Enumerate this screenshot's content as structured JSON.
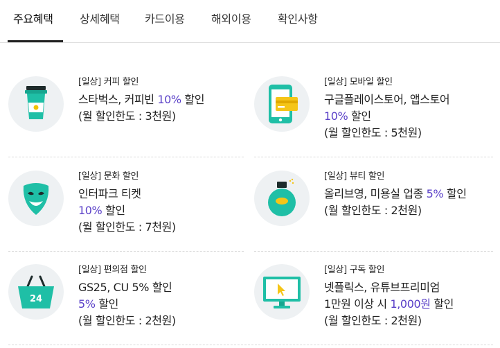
{
  "tabs": [
    {
      "label": "주요혜택"
    },
    {
      "label": "상세혜택"
    },
    {
      "label": "카드이용"
    },
    {
      "label": "해외이용"
    },
    {
      "label": "확인사항"
    }
  ],
  "benefits": [
    {
      "category": "[일상] 커피 할인",
      "line1_pre": "스타벅스, 커피빈 ",
      "line1_hl": "10%",
      "line1_post": " 할인",
      "line2_pre": "(월 할인한도 : 3천원)",
      "line2_hl": "",
      "line2_post": "",
      "line3": "",
      "icon": "coffee-cup-icon"
    },
    {
      "category": "[일상] 모바일 할인",
      "line1_pre": "구글플레이스토어, 앱스토어",
      "line1_hl": "",
      "line1_post": "",
      "line2_pre": "",
      "line2_hl": "10%",
      "line2_post": " 할인",
      "line3": "(월 할인한도 : 5천원)",
      "icon": "smartphone-card-icon"
    },
    {
      "category": "[일상] 문화 할인",
      "line1_pre": "인터파크 티켓",
      "line1_hl": "",
      "line1_post": "",
      "line2_pre": "",
      "line2_hl": "10%",
      "line2_post": " 할인",
      "line3": "(월 할인한도 : 7천원)",
      "icon": "theater-mask-icon"
    },
    {
      "category": "[일상] 뷰티 할인",
      "line1_pre": "올리브영, 미용실 업종 ",
      "line1_hl": "5%",
      "line1_post": " 할인",
      "line2_pre": "(월 할인한도 : 2천원)",
      "line2_hl": "",
      "line2_post": "",
      "line3": "",
      "icon": "perfume-bottle-icon"
    },
    {
      "category": "[일상] 편의점 할인",
      "line1_pre": "GS25, CU 5% 할인",
      "line1_hl": "",
      "line1_post": "",
      "line2_pre": "",
      "line2_hl": "5%",
      "line2_post": " 할인",
      "line3": "(월 할인한도 : 2천원)",
      "icon": "shopping-basket-24-icon"
    },
    {
      "category": "[일상] 구독 할인",
      "line1_pre": "넷플릭스, 유튜브프리미엄",
      "line1_hl": "",
      "line1_post": "",
      "line2_pre": "1만원 이상 시 ",
      "line2_hl": "1,000원",
      "line2_post": " 할인",
      "line3": "(월 할인한도 : 2천원)",
      "icon": "monitor-cursor-icon"
    }
  ],
  "basket_label": "24",
  "colors": {
    "accent": "#5a40c8",
    "teal": "#1fbfa6",
    "icon_bg": "#eef1f3"
  }
}
